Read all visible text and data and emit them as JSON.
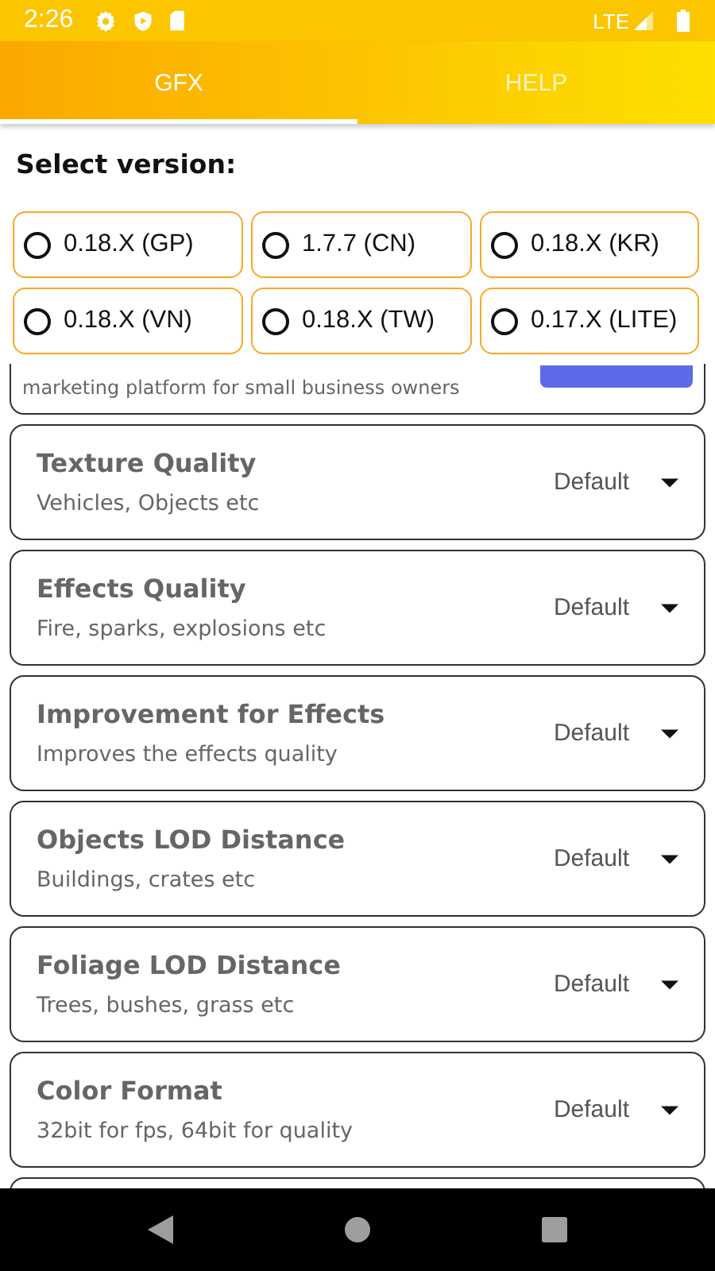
{
  "status_bar": {
    "time": "2:26",
    "network": "LTE"
  },
  "tabs": [
    {
      "label": "GFX",
      "selected": true
    },
    {
      "label": "HELP",
      "selected": false
    }
  ],
  "heading": "Select version:",
  "versions": [
    {
      "label": "0.18.X (GP)",
      "selected": false
    },
    {
      "label": "1.7.7 (CN)",
      "selected": false
    },
    {
      "label": "0.18.X (KR)",
      "selected": false
    },
    {
      "label": "0.18.X (VN)",
      "selected": false
    },
    {
      "label": "0.18.X (TW)",
      "selected": false
    },
    {
      "label": "0.17.X (LITE)",
      "selected": false
    }
  ],
  "ad": {
    "text": "marketing platform for small business owners"
  },
  "settings": [
    {
      "title": "Texture Quality",
      "subtitle": "Vehicles, Objects etc",
      "value": "Default"
    },
    {
      "title": "Effects Quality",
      "subtitle": "Fire, sparks, explosions etc",
      "value": "Default"
    },
    {
      "title": "Improvement for Effects",
      "subtitle": "Improves the effects quality",
      "value": "Default"
    },
    {
      "title": "Objects LOD Distance",
      "subtitle": "Buildings, crates etc",
      "value": "Default"
    },
    {
      "title": "Foliage LOD Distance",
      "subtitle": "Trees, bushes, grass etc",
      "value": "Default"
    },
    {
      "title": "Color Format",
      "subtitle": "32bit for fps, 64bit for quality",
      "value": "Default"
    }
  ]
}
